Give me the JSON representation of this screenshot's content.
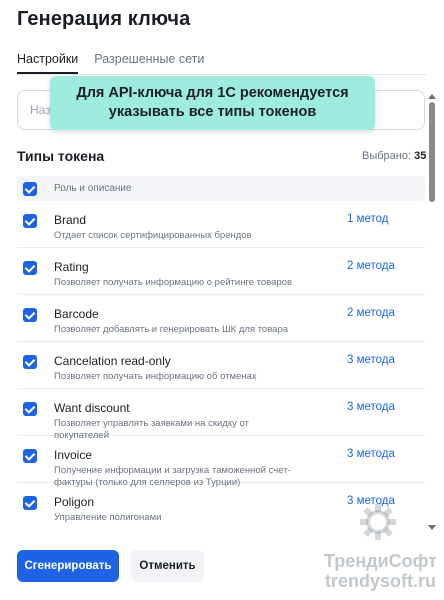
{
  "dialog": {
    "title": "Генерация ключа"
  },
  "tabs": [
    {
      "label": "Настройки",
      "active": true
    },
    {
      "label": "Разрешенные сети",
      "active": false
    }
  ],
  "name_input": {
    "placeholder": "Название ключа",
    "value": ""
  },
  "tooltip": {
    "line1": "Для API-ключа для 1С рекомендуется",
    "line2": "указывать все типы токенов"
  },
  "token_types": {
    "title": "Типы токена",
    "selected_label": "Выбрано:",
    "selected_count": "35",
    "column_header": "Роль и описание",
    "header_checked": true,
    "rows": [
      {
        "name": "Brand",
        "description": "Отдает список сертифицированных брендов",
        "methods": "1 метод",
        "checked": true
      },
      {
        "name": "Rating",
        "description": "Позволяет получать информацию о рейтинге товаров",
        "methods": "2 метода",
        "checked": true
      },
      {
        "name": "Barcode",
        "description": "Позволяет добавлять и генерировать ШК для товара",
        "methods": "2 метода",
        "checked": true
      },
      {
        "name": "Cancelation read-only",
        "description": "Позволяет получать информацию об отменах",
        "methods": "3 метода",
        "checked": true
      },
      {
        "name": "Want discount",
        "description": "Позволяет управлять заявками на скидку от покупателей",
        "methods": "3 метода",
        "checked": true
      },
      {
        "name": "Invoice",
        "description": "Получение информации и загрузка таможенной счет-фактуры (только для селлеров из Турции)",
        "methods": "3 метода",
        "checked": true
      },
      {
        "name": "Poligon",
        "description": "Управление полигонами",
        "methods": "3 метода",
        "checked": true
      }
    ]
  },
  "actions": {
    "generate_label": "Сгенерировать",
    "cancel_label": "Отменить"
  },
  "watermark": {
    "line1": "ТрендиСофт",
    "line2": "trendysoft.ru"
  },
  "colors": {
    "accent": "#1e63e6",
    "tooltip_bg": "#9decde",
    "muted_text": "#6a7380"
  }
}
